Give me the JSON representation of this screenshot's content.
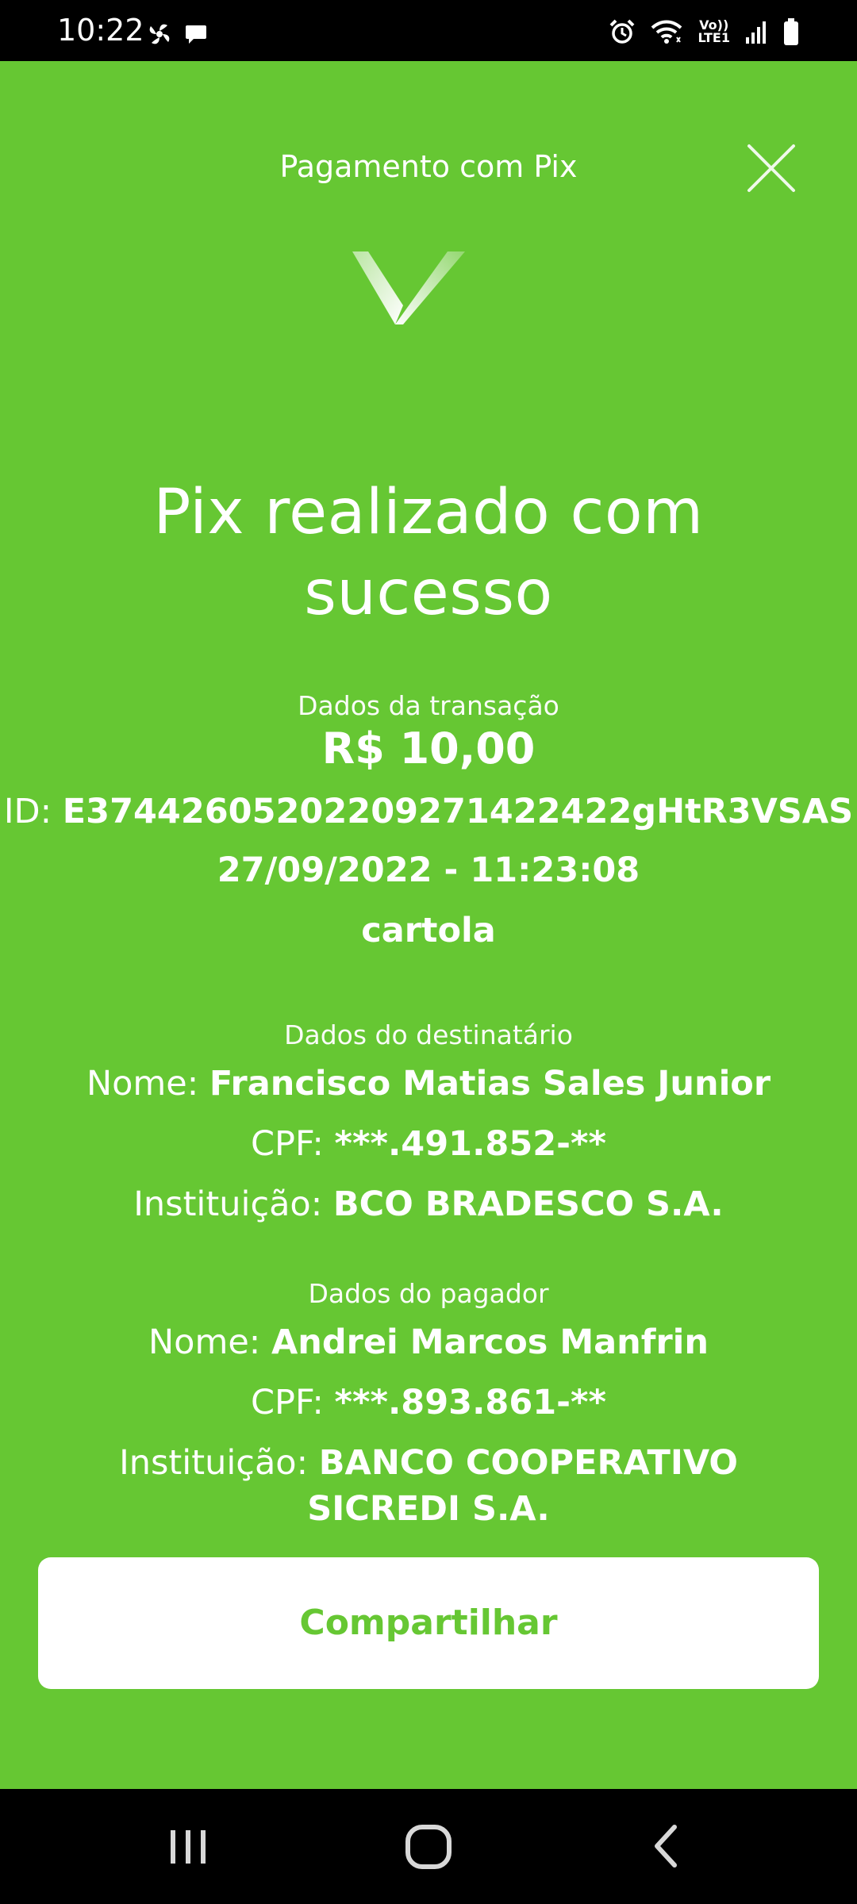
{
  "status_bar": {
    "time": "10:22",
    "left_icons": [
      "pinwheel-icon",
      "chat-bubble-icon"
    ],
    "right_icons": [
      "alarm-icon",
      "wifi-icon",
      "volte-lte-icon",
      "signal-icon",
      "battery-icon"
    ],
    "volte_line1": "Vo))",
    "volte_line2": "LTE1"
  },
  "header": {
    "title": "Pagamento com Pix",
    "close_icon": "close-icon"
  },
  "success": {
    "icon": "check-icon",
    "headline_line1": "Pix realizado com",
    "headline_line2": "sucesso"
  },
  "transaction": {
    "section_label": "Dados da transação",
    "amount": "R$ 10,00",
    "id_label": "ID:",
    "id_value": "E37442605202209271422422gHtR3VSAS",
    "datetime": "27/09/2022 - 11:23:08",
    "description": "cartola"
  },
  "recipient": {
    "section_label": "Dados do destinatário",
    "name_label": "Nome:",
    "name_value": "Francisco Matias Sales Junior",
    "cpf_label": "CPF:",
    "cpf_value": "***.491.852-**",
    "institution_label": "Instituição:",
    "institution_value": "BCO BRADESCO S.A."
  },
  "payer": {
    "section_label": "Dados do pagador",
    "name_label": "Nome:",
    "name_value": "Andrei Marcos Manfrin",
    "cpf_label": "CPF:",
    "cpf_value": "***.893.861-**",
    "institution_label": "Instituição:",
    "institution_value": "BANCO COOPERATIVO SICREDI S.A."
  },
  "actions": {
    "share_label": "Compartilhar"
  },
  "navigation": {
    "buttons": [
      "recent-apps-icon",
      "home-icon",
      "back-icon"
    ]
  },
  "colors": {
    "brand_green": "#66c733",
    "text_white": "#ffffff",
    "system_bar": "#000000"
  }
}
